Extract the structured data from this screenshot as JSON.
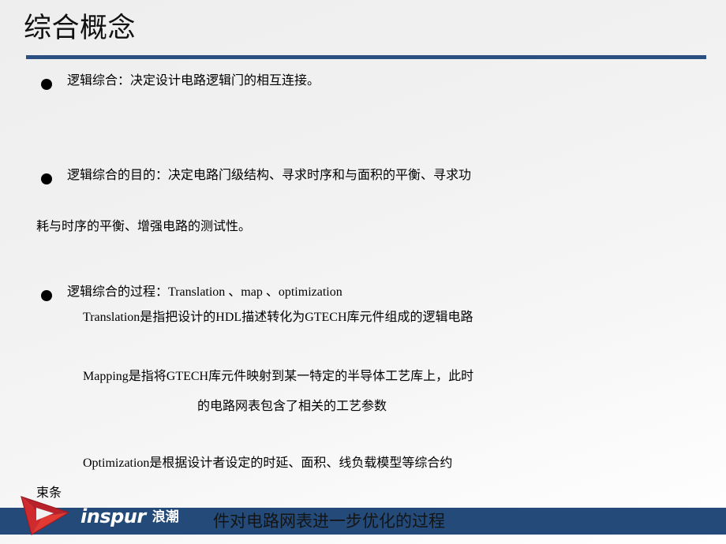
{
  "slide": {
    "title": "综合概念",
    "accent_color": "#2a5082",
    "footer_bar_color": "#234a78",
    "background_color": "#f1f1f1",
    "bullet_glyph": "●"
  },
  "bullets": [
    {
      "id": "logic-synthesis-definition",
      "text": "逻辑综合：决定设计电路逻辑门的相互连接。"
    },
    {
      "id": "logic-synthesis-purpose",
      "text": "逻辑综合的目的：决定电路门级结构、寻求时序和与面积的平衡、寻求功",
      "wrap": "耗与时序的平衡、增强电路的测试性。"
    },
    {
      "id": "logic-synthesis-process",
      "text": "逻辑综合的过程：Translation 、map 、optimization"
    }
  ],
  "process_lines": [
    {
      "id": "translation-line",
      "text": "Translation是指把设计的HDL描述转化为GTECH库元件组成的逻辑电路"
    },
    {
      "id": "mapping-line-1",
      "text": "Mapping是指将GTECH库元件映射到某一特定的半导体工艺库上，此时"
    },
    {
      "id": "mapping-line-2",
      "text": "的电路网表包含了相关的工艺参数"
    },
    {
      "id": "optimization-line-1",
      "text": "Optimization是根据设计者设定的时延、面积、线负载模型等综合约"
    },
    {
      "id": "optimization-line-2",
      "text": "束条"
    },
    {
      "id": "optimization-line-3",
      "text": "件对电路网表进一步优化的过程"
    }
  ],
  "footer": {
    "logo_text": "inspur",
    "logo_text_cn": "浪潮",
    "logo_mark_color": "#c1272d",
    "logo_mark_highlight": "#e8443a"
  }
}
